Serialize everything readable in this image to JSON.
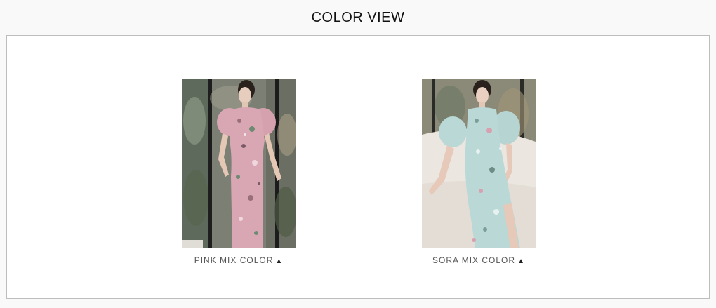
{
  "section": {
    "title": "COLOR VIEW"
  },
  "colors": [
    {
      "label": "PINK MIX COLOR",
      "indicator": "▲",
      "swatch": "#d9a7b4",
      "image_icon": "model-pink-dress-photo"
    },
    {
      "label": "SORA MIX COLOR",
      "indicator": "▲",
      "swatch": "#b9d8d6",
      "image_icon": "model-sora-dress-photo"
    }
  ],
  "palette": {
    "background": "#f9f9f9",
    "frame_border": "#bdbdbd"
  }
}
